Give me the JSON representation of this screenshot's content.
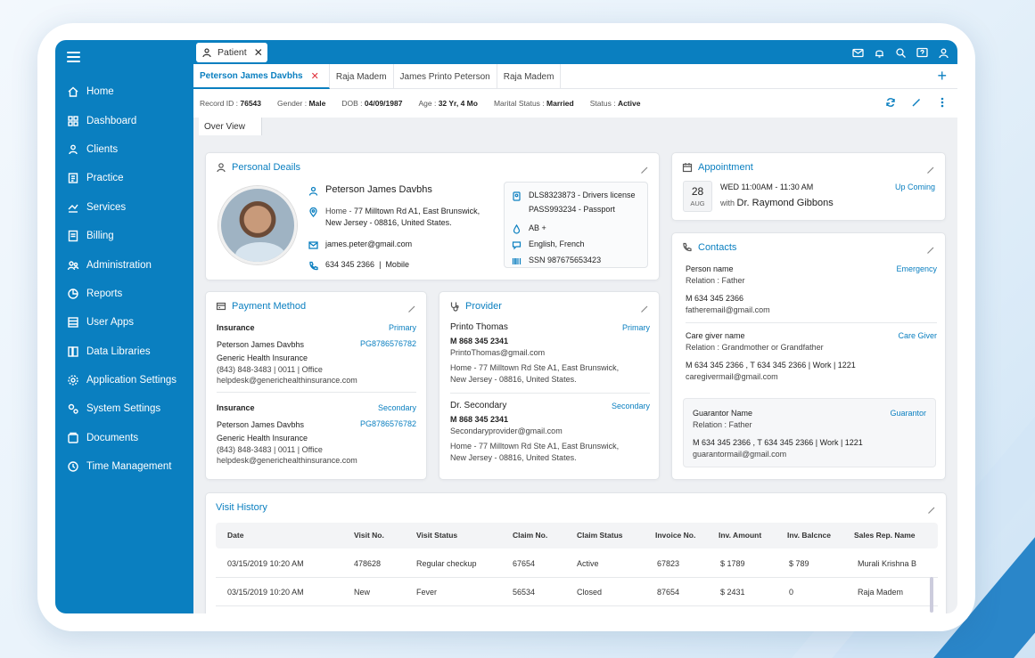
{
  "sidebar": {
    "items": [
      {
        "label": "Home",
        "icon": "home-icon"
      },
      {
        "label": "Dashboard",
        "icon": "dashboard-icon"
      },
      {
        "label": "Clients",
        "icon": "clients-icon"
      },
      {
        "label": "Practice",
        "icon": "practice-icon"
      },
      {
        "label": "Services",
        "icon": "services-icon"
      },
      {
        "label": "Billing",
        "icon": "billing-icon"
      },
      {
        "label": "Administration",
        "icon": "administration-icon"
      },
      {
        "label": "Reports",
        "icon": "reports-icon"
      },
      {
        "label": "User Apps",
        "icon": "user-apps-icon"
      },
      {
        "label": "Data Libraries",
        "icon": "data-libraries-icon"
      },
      {
        "label": "Application Settings",
        "icon": "application-settings-icon"
      },
      {
        "label": "System Settings",
        "icon": "system-settings-icon"
      },
      {
        "label": "Documents",
        "icon": "documents-icon"
      },
      {
        "label": "Time Management",
        "icon": "time-management-icon"
      }
    ]
  },
  "topbar": {
    "tab_label": "Patient",
    "close_glyph": "✕",
    "icons": [
      "mail-icon",
      "bell-icon",
      "search-icon",
      "help-icon",
      "user-icon"
    ]
  },
  "patient_tabs": [
    {
      "label": "Peterson James Davbhs",
      "active": true
    },
    {
      "label": "Raja Madem"
    },
    {
      "label": "James Printo Peterson"
    },
    {
      "label": "Raja Madem"
    }
  ],
  "patient_tabs_close": "✕",
  "patient_tabs_add": "+",
  "info": {
    "record_label": "Record ID :",
    "record": "76543",
    "gender_label": "Gender :",
    "gender": "Male",
    "dob_label": "DOB :",
    "dob": "04/09/1987",
    "age_label": "Age :",
    "age": "32 Yr, 4 Mo",
    "marital_label": "Marital Status :",
    "marital": "Married",
    "status_label": "Status :",
    "status": "Active"
  },
  "overview_tab": "Over View",
  "personal": {
    "title": "Personal Deails",
    "name": "Peterson James Davbhs",
    "address_label": "Home -",
    "address_line1": "77 Milltown Rd A1, East Brunswick,",
    "address_line2": "New Jersey - 08816, United States.",
    "email": "james.peter@gmail.com",
    "phone": "634 345 2366",
    "phone_sep": "|",
    "phone_type": "Mobile",
    "ids_line1": "DLS8323873 - Drivers license",
    "ids_line2": "PASS993234 - Passport",
    "blood": "AB +",
    "languages": "English, French",
    "ssn": "SSN 987675653423"
  },
  "appointment": {
    "title": "Appointment",
    "day": "28",
    "month": "AUG",
    "time": "WED 11:00AM - 11:30 AM",
    "with_label": "with",
    "doctor": "Dr. Raymond Gibbons",
    "status": "Up Coming"
  },
  "contacts": {
    "title": "Contacts",
    "items": [
      {
        "name": "Person name",
        "relation": "Relation : Father",
        "tag": "Emergency",
        "phones": "M 634 345 2366",
        "email": "fatheremail@gmail.com"
      },
      {
        "name": "Care giver name",
        "relation": "Relation : Grandmother or Grandfather",
        "tag": "Care Giver",
        "phones": "M 634 345 2366 , T 634 345 2366  |  Work  |  1221",
        "email": "caregivermail@gmail.com"
      },
      {
        "name": "Guarantor Name",
        "relation": "Relation : Father",
        "tag": "Guarantor",
        "phones": "M 634 345 2366 , T 634 345 2366  |  Work  |  1221",
        "email": "guarantormail@gmail.com"
      }
    ]
  },
  "payment": {
    "title": "Payment Method",
    "items": [
      {
        "heading": "Insurance",
        "tag": "Primary",
        "name": "Peterson James Davbhs",
        "policy": "PG8786576782",
        "company": "Generic Health Insurance",
        "phone": "(843) 848-3483  |  0011  |  Office",
        "email": "helpdesk@generichealthinsurance.com"
      },
      {
        "heading": "Insurance",
        "tag": "Secondary",
        "name": "Peterson James Davbhs",
        "policy": "PG8786576782",
        "company": "Generic Health Insurance",
        "phone": "(843) 848-3483  |  0011  |  Office",
        "email": "helpdesk@generichealthinsurance.com"
      }
    ]
  },
  "provider": {
    "title": "Provider",
    "items": [
      {
        "name": "Printo Thomas",
        "tag": "Primary",
        "phone": "M 868 345 2341",
        "email": "PrintoThomas@gmail.com",
        "address1": "Home - 77 Milltown Rd Ste A1, East Brunswick,",
        "address2": "New Jersey - 08816, United States."
      },
      {
        "name": "Dr. Secondary",
        "tag": "Secondary",
        "phone": "M 868 345 2341",
        "email": "Secondaryprovider@gmail.com",
        "address1": "Home - 77 Milltown Rd Ste A1, East Brunswick,",
        "address2": "New Jersey - 08816, United States."
      }
    ]
  },
  "visit_history": {
    "title": "Visit History",
    "columns": [
      "Date",
      "Visit No.",
      "Visit Status",
      "Claim No.",
      "Claim Status",
      "Invoice No.",
      "Inv. Amount",
      "Inv. Balcnce",
      "Sales Rep. Name"
    ],
    "rows": [
      [
        "03/15/2019 10:20 AM",
        "478628",
        "Regular checkup",
        "67654",
        "Active",
        "67823",
        "$ 1789",
        "$ 789",
        "Murali Krishna B"
      ],
      [
        "03/15/2019 10:20 AM",
        "New",
        "Fever",
        "56534",
        "Closed",
        "87654",
        "$ 2431",
        "0",
        "Raja Madem"
      ]
    ]
  },
  "colors": {
    "primary": "#0a7fc0",
    "close_red": "#e0303a"
  }
}
